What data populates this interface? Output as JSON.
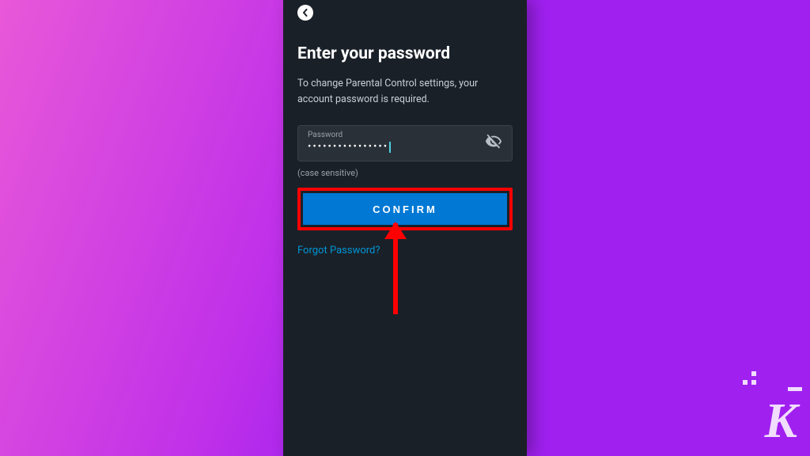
{
  "screen": {
    "title": "Enter your password",
    "subtitle": "To change Parental Control settings, your account password is required."
  },
  "passwordField": {
    "label": "Password",
    "maskedValue": "••••••••••••••••",
    "hint": "(case sensitive)"
  },
  "buttons": {
    "confirm": "CONFIRM"
  },
  "links": {
    "forgot": "Forgot Password?"
  },
  "icons": {
    "back": "chevron-left",
    "visibility": "eye-off"
  },
  "annotation": {
    "highlightColor": "#ff0000",
    "arrowTarget": "confirm-button"
  },
  "watermark": {
    "letter": "K"
  }
}
